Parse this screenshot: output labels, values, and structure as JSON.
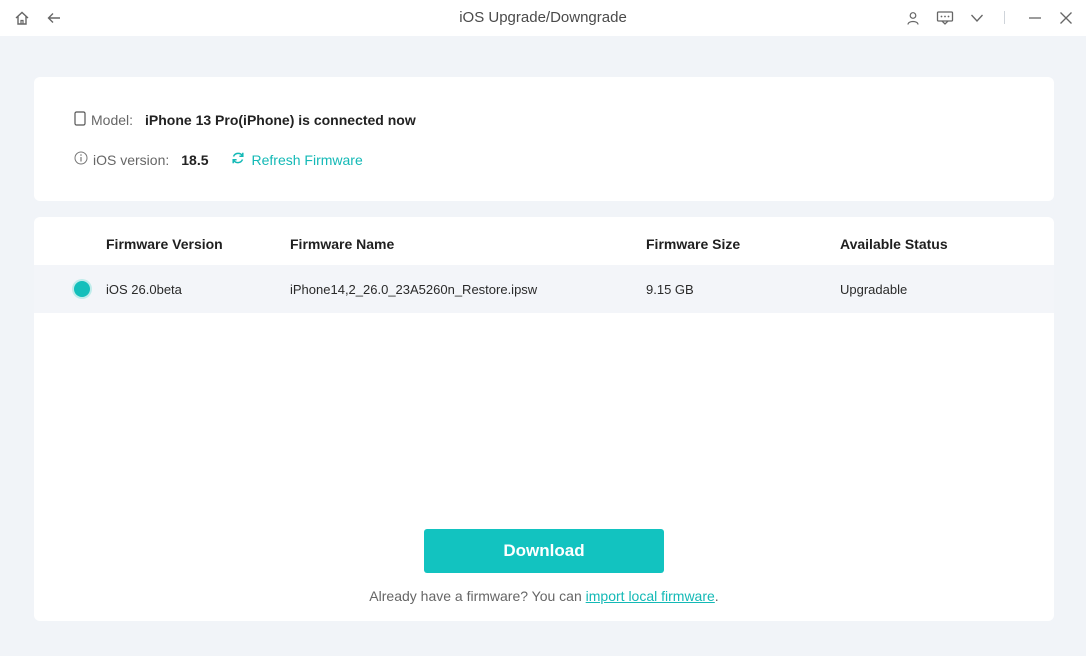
{
  "titlebar": {
    "title": "iOS Upgrade/Downgrade",
    "icons": [
      "home-icon",
      "back-arrow-icon",
      "user-icon",
      "feedback-icon",
      "dropdown-icon",
      "minimize-icon",
      "close-icon"
    ]
  },
  "device": {
    "model_label": "Model:",
    "model_value": "iPhone 13 Pro(iPhone) is connected now",
    "ios_label": "iOS version:",
    "ios_value": "18.5",
    "refresh_label": "Refresh Firmware"
  },
  "table": {
    "headers": [
      "Firmware Version",
      "Firmware Name",
      "Firmware Size",
      "Available Status"
    ],
    "rows": [
      {
        "selected": true,
        "version": "iOS 26.0beta",
        "name": "iPhone14,2_26.0_23A5260n_Restore.ipsw",
        "size": "9.15 GB",
        "status": "Upgradable"
      }
    ]
  },
  "actions": {
    "download_label": "Download",
    "import_prefix": "Already have a firmware? You can ",
    "import_link": "import local firmware",
    "import_suffix": "."
  },
  "colors": {
    "accent": "#12c3c0",
    "background": "#f1f4f8",
    "card": "#ffffff"
  }
}
